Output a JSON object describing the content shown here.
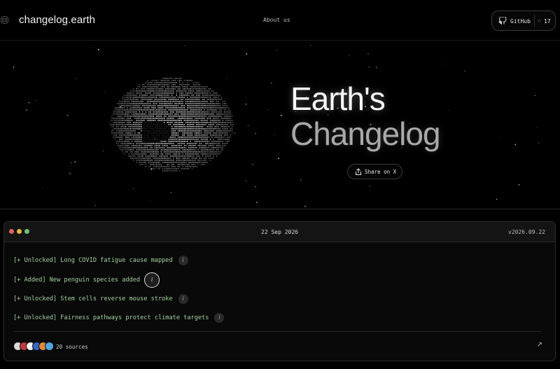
{
  "header": {
    "logo_text": "changelog.earth",
    "nav_about": "About us",
    "github": {
      "label": "GitHub",
      "stars": "17",
      "star_icon": "star-icon"
    }
  },
  "hero": {
    "title_line1": "Earth's",
    "title_line2": "Changelog",
    "share_label": "Share on X"
  },
  "panel": {
    "date": "22 Sep 2026",
    "version": "v2026.09.22",
    "window_dots": [
      "#e5635b",
      "#e2b648",
      "#72c279"
    ],
    "entries": [
      {
        "text": "[+ Unlocked] Long COVID fatigue cause mapped"
      },
      {
        "text": "[+ Added] New penguin species added"
      },
      {
        "text": "[+ Unlocked] Stem cells reverse mouse stroke"
      },
      {
        "text": "[+ Unlocked] Fairness pathways protect climate targets"
      }
    ],
    "info_glyph": "i",
    "sources_label": "20 sources",
    "arrow_glyph": "↗"
  },
  "colors": {
    "background": "#000000",
    "entry_text": "#a4d2a0",
    "panel_bar": "#141414"
  }
}
